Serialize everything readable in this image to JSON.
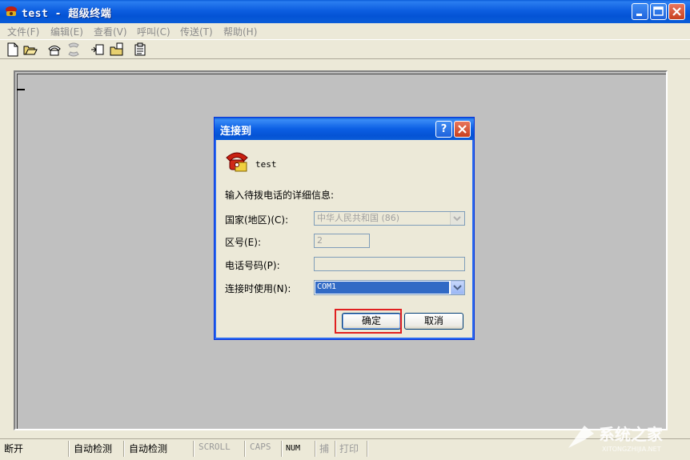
{
  "window": {
    "title": "test - 超级终端",
    "icons": {
      "app": "hyperterminal-icon",
      "minimize": "minimize-icon",
      "maximize": "maximize-icon",
      "close": "close-icon"
    }
  },
  "menu": [
    "文件(F)",
    "编辑(E)",
    "查看(V)",
    "呼叫(C)",
    "传送(T)",
    "帮助(H)"
  ],
  "toolbar": [
    "new-icon",
    "open-icon",
    "call-icon",
    "disconnect-icon",
    "send-icon",
    "receive-icon",
    "properties-icon"
  ],
  "dialog": {
    "title": "连接到",
    "help": "?",
    "connection_name": "test",
    "prompt": "输入待拨电话的详细信息:",
    "country_label": "国家(地区)(C):",
    "country_value": "中华人民共和国 (86)",
    "area_label": "区号(E):",
    "area_value": "2",
    "phone_label": "电话号码(P):",
    "phone_value": "",
    "connect_using_label": "连接时使用(N):",
    "connect_using_value": "COM1",
    "ok": "确定",
    "cancel": "取消"
  },
  "status": {
    "state": "断开",
    "detect1": "自动检测",
    "detect2": "自动检测",
    "scroll": "SCROLL",
    "caps": "CAPS",
    "num": "NUM",
    "capture": "捕",
    "print": "打印"
  },
  "watermark": {
    "text": "系统之家",
    "sub": "XITONGZHIJIA.NET"
  },
  "colors": {
    "titlebar": "#0a5cd8",
    "highlight": "#e02020",
    "selection": "#316ac5"
  }
}
